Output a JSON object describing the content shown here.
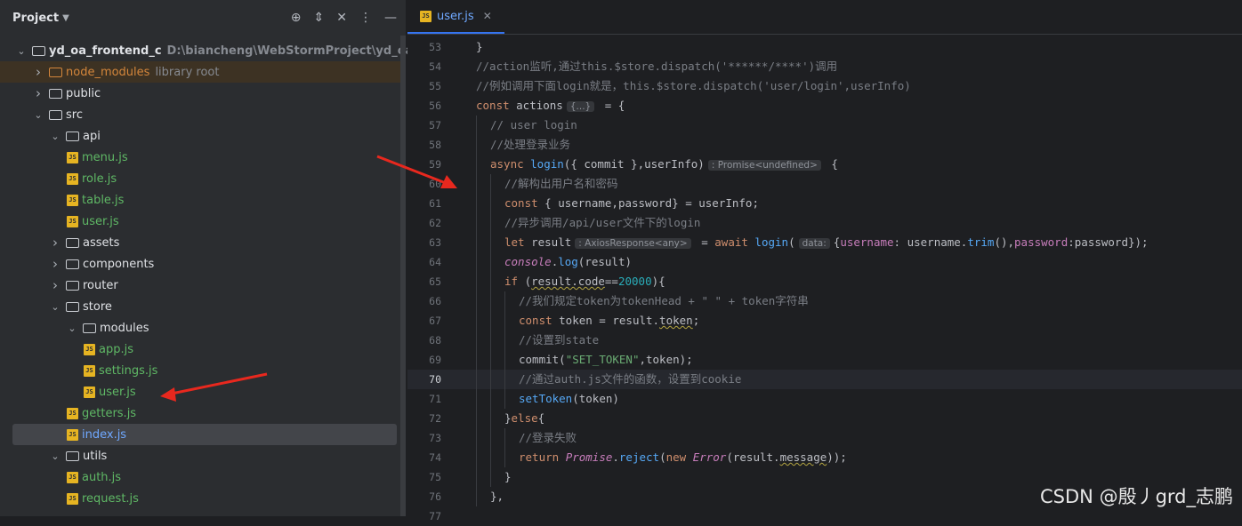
{
  "project_panel": {
    "title": "Project",
    "tree": [
      {
        "depth": 0,
        "type": "folder",
        "expanded": true,
        "label": "yd_oa_frontend_c",
        "hint": "D:\\biancheng\\WebStormProject\\yd_oa_frontend_c",
        "bold": true
      },
      {
        "depth": 1,
        "type": "folder",
        "expanded": false,
        "label": "node_modules",
        "hint": "library root",
        "style": "lib"
      },
      {
        "depth": 1,
        "type": "folder",
        "expanded": false,
        "label": "public"
      },
      {
        "depth": 1,
        "type": "folder",
        "expanded": true,
        "label": "src"
      },
      {
        "depth": 2,
        "type": "folder",
        "expanded": true,
        "label": "api"
      },
      {
        "depth": 3,
        "type": "file",
        "label": "menu.js"
      },
      {
        "depth": 3,
        "type": "file",
        "label": "role.js"
      },
      {
        "depth": 3,
        "type": "file",
        "label": "table.js"
      },
      {
        "depth": 3,
        "type": "file",
        "label": "user.js"
      },
      {
        "depth": 2,
        "type": "folder",
        "expanded": false,
        "label": "assets"
      },
      {
        "depth": 2,
        "type": "folder",
        "expanded": false,
        "label": "components"
      },
      {
        "depth": 2,
        "type": "folder",
        "expanded": false,
        "label": "router"
      },
      {
        "depth": 2,
        "type": "folder",
        "expanded": true,
        "label": "store"
      },
      {
        "depth": 3,
        "type": "folder",
        "expanded": true,
        "label": "modules"
      },
      {
        "depth": 4,
        "type": "file",
        "label": "app.js"
      },
      {
        "depth": 4,
        "type": "file",
        "label": "settings.js"
      },
      {
        "depth": 4,
        "type": "file",
        "label": "user.js"
      },
      {
        "depth": 3,
        "type": "file",
        "label": "getters.js"
      },
      {
        "depth": 3,
        "type": "file",
        "label": "index.js",
        "selected": true
      },
      {
        "depth": 2,
        "type": "folder",
        "expanded": true,
        "label": "utils"
      },
      {
        "depth": 3,
        "type": "file",
        "label": "auth.js"
      },
      {
        "depth": 3,
        "type": "file",
        "label": "request.js"
      }
    ]
  },
  "editor": {
    "tab_label": "user.js",
    "tab_icon": "JS",
    "current_line": 70
  },
  "code_lines": [
    {
      "n": "53",
      "indent": 0,
      "t": [
        [
          "}",
          ""
        ]
      ]
    },
    {
      "n": "54",
      "indent": 0,
      "t": [
        [
          "//action监听,通过this.$store.dispatch('******/****')调用",
          "cm"
        ]
      ]
    },
    {
      "n": "55",
      "indent": 0,
      "t": [
        [
          "//例如调用下面login就是，this.$store.dispatch('user/login',userInfo)",
          "cm"
        ]
      ]
    },
    {
      "n": "56",
      "indent": 0,
      "t": [
        [
          "const ",
          "kw"
        ],
        [
          "actions",
          ""
        ],
        [
          "{...}",
          "inlay"
        ],
        [
          " = {",
          ""
        ]
      ]
    },
    {
      "n": "57",
      "indent": 1,
      "t": [
        [
          "// user login",
          "cm"
        ]
      ]
    },
    {
      "n": "58",
      "indent": 1,
      "t": [
        [
          "//处理登录业务",
          "cm"
        ]
      ]
    },
    {
      "n": "59",
      "indent": 1,
      "t": [
        [
          "async ",
          "kw"
        ],
        [
          "login",
          "fn"
        ],
        [
          "({ commit },userInfo)",
          ""
        ],
        [
          ": Promise<undefined>",
          "inlay"
        ],
        [
          " {",
          ""
        ]
      ]
    },
    {
      "n": "60",
      "indent": 2,
      "t": [
        [
          "//解构出用户名和密码",
          "cm"
        ]
      ]
    },
    {
      "n": "61",
      "indent": 2,
      "t": [
        [
          "const ",
          "kw"
        ],
        [
          "{ username,password} = userInfo;",
          ""
        ]
      ]
    },
    {
      "n": "62",
      "indent": 2,
      "t": [
        [
          "//异步调用/api/user文件下的login",
          "cm"
        ]
      ]
    },
    {
      "n": "63",
      "indent": 2,
      "t": [
        [
          "let ",
          "kw"
        ],
        [
          "result",
          ""
        ],
        [
          ": AxiosResponse<any>",
          "inlay"
        ],
        [
          " = ",
          ""
        ],
        [
          "await ",
          "kw"
        ],
        [
          "login",
          "fn"
        ],
        [
          "(",
          ""
        ],
        [
          "data:",
          "inlay"
        ],
        [
          "{",
          ""
        ],
        [
          "username",
          "prop"
        ],
        [
          ": username.",
          ""
        ],
        [
          "trim",
          "fn"
        ],
        [
          "(),",
          ""
        ],
        [
          "password",
          "prop"
        ],
        [
          ":password});",
          ""
        ]
      ]
    },
    {
      "n": "64",
      "indent": 2,
      "t": [
        [
          "console",
          "tag"
        ],
        [
          ".",
          ""
        ],
        [
          "log",
          "fn"
        ],
        [
          "(result)",
          ""
        ]
      ]
    },
    {
      "n": "65",
      "indent": 2,
      "t": [
        [
          "if ",
          "kw"
        ],
        [
          "(",
          ""
        ],
        [
          "result.code",
          "squig"
        ],
        [
          "==",
          ""
        ],
        [
          "20000",
          "num"
        ],
        [
          "){",
          ""
        ]
      ]
    },
    {
      "n": "66",
      "indent": 3,
      "t": [
        [
          "//我们规定token为tokenHead + \" \" + token字符串",
          "cm"
        ]
      ]
    },
    {
      "n": "67",
      "indent": 3,
      "t": [
        [
          "const ",
          "kw"
        ],
        [
          "token = result.",
          ""
        ],
        [
          "token",
          "squig"
        ],
        [
          ";",
          ""
        ]
      ]
    },
    {
      "n": "68",
      "indent": 3,
      "t": [
        [
          "//设置到state",
          "cm"
        ]
      ]
    },
    {
      "n": "69",
      "indent": 3,
      "t": [
        [
          "commit(",
          ""
        ],
        [
          "\"SET_TOKEN\"",
          "str"
        ],
        [
          ",token);",
          ""
        ]
      ]
    },
    {
      "n": "70",
      "indent": 3,
      "t": [
        [
          "//通过auth.js文件的函数，设置到cookie",
          "cm"
        ]
      ]
    },
    {
      "n": "71",
      "indent": 3,
      "t": [
        [
          "setToken",
          "fn"
        ],
        [
          "(token)",
          ""
        ]
      ]
    },
    {
      "n": "72",
      "indent": 2,
      "t": [
        [
          "}",
          ""
        ],
        [
          "else",
          "kw"
        ],
        [
          "{",
          ""
        ]
      ]
    },
    {
      "n": "73",
      "indent": 3,
      "t": [
        [
          "//登录失败",
          "cm"
        ]
      ]
    },
    {
      "n": "74",
      "indent": 3,
      "t": [
        [
          "return ",
          "kw"
        ],
        [
          "Promise",
          "tag"
        ],
        [
          ".",
          ""
        ],
        [
          "reject",
          "fn"
        ],
        [
          "(",
          ""
        ],
        [
          "new ",
          "kw"
        ],
        [
          "Error",
          "tag"
        ],
        [
          "(result.",
          ""
        ],
        [
          "message",
          "squig"
        ],
        [
          "));",
          ""
        ]
      ]
    },
    {
      "n": "75",
      "indent": 2,
      "t": [
        [
          "}",
          ""
        ]
      ]
    },
    {
      "n": "76",
      "indent": 1,
      "t": [
        [
          "},",
          ""
        ]
      ]
    },
    {
      "n": "77",
      "indent": 0,
      "t": [
        [
          "",
          ""
        ]
      ]
    }
  ],
  "watermark": "CSDN @殷丿grd_志鹏",
  "colors": {
    "arrow": "#e8281e",
    "selection": "#43454a",
    "accent": "#3574f0"
  }
}
